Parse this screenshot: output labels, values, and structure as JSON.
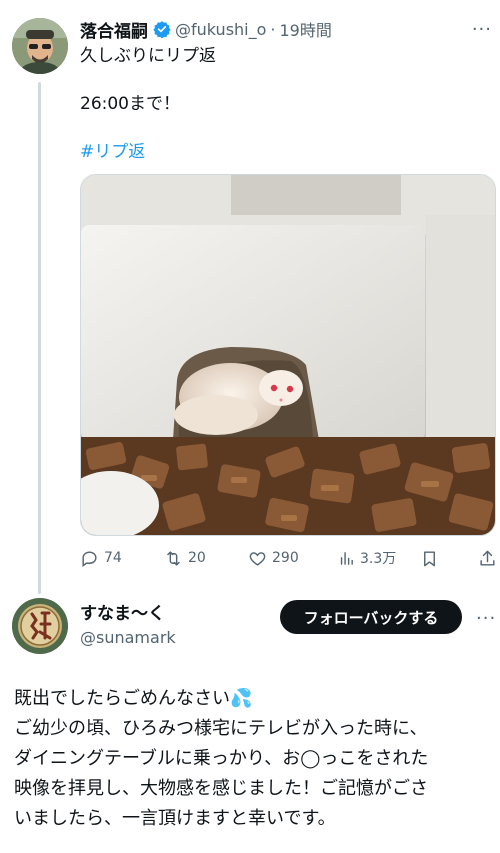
{
  "tweet": {
    "author": {
      "name": "落合福嗣",
      "handle": "@fukushi_o",
      "separator": "·",
      "time": "19時間",
      "verified": true,
      "verified_color": "#1d9bf0",
      "more_label": "···"
    },
    "lines": {
      "line1": "久しぶりにリプ返",
      "line2": "26:00まで！",
      "hashtag": "#リプ返"
    },
    "media": {
      "icon": "snake-photo"
    },
    "actions": {
      "replies": "74",
      "retweets": "20",
      "likes": "290",
      "views": "3.3万"
    }
  },
  "reply": {
    "author": {
      "name": "すなま〜く",
      "handle": "@sunamark"
    },
    "follow_label": "フォローバックする",
    "more_label": "···",
    "lines": [
      "既出でしたらごめんなさい💦",
      "ご幼少の頃、ひろみつ様宅にテレビが入った時に、",
      "ダイニングテーブルに乗っかり、お◯っこをされた",
      "映像を拝見し、大物感を感じました！ご記憶がごさ",
      "いましたら、一言頂けますと幸いです。"
    ]
  },
  "colors": {
    "accent": "#1d9bf0",
    "text": "#0f1419",
    "muted": "#536471",
    "button": "#0f1419"
  }
}
